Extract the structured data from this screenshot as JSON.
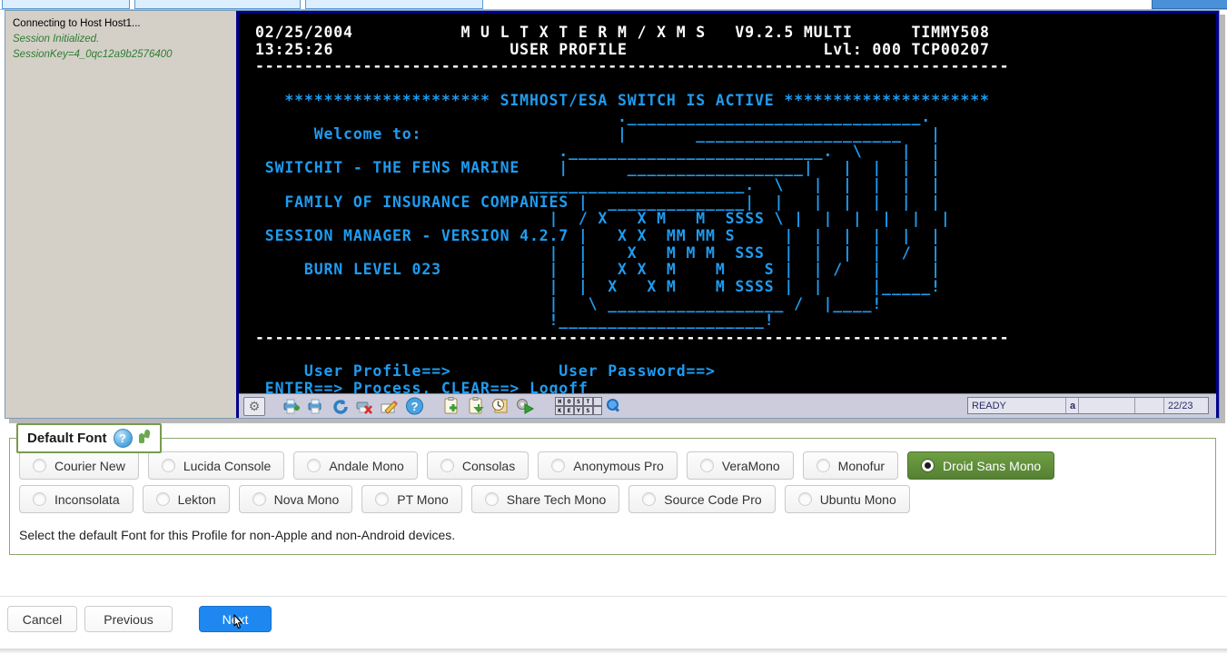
{
  "tabstrip": {
    "tabs": [
      "",
      "",
      "",
      ""
    ]
  },
  "session": {
    "status_line": "Connecting to Host Host1...",
    "initialized": "Session Initialized.",
    "session_key": "SessionKey=4_0qc12a9b2576400"
  },
  "terminal": {
    "date": "02/25/2004",
    "time": "13:25:26",
    "product": "M U L T X T E R M / X M S",
    "version": "V9.2.5 MULTI",
    "user_id": "TIMMY508",
    "screen_title": "USER PROFILE",
    "level": "Lvl: 000",
    "tcp": "TCP00207",
    "banner": "********************* SIMHOST/ESA SWITCH IS ACTIVE *********************",
    "welcome": "Welcome to:",
    "company_line1": "SWITCHIT - THE FENS MARINE",
    "company_line2": "FAMILY OF INSURANCE COMPANIES",
    "company_line3": "SESSION MANAGER - VERSION 4.2.7",
    "company_line4": "BURN LEVEL 023",
    "prompt_profile": "User Profile==>",
    "prompt_password": "User Password==>",
    "action_line": "ENTER==> Process, CLEAR==> Logoff",
    "divider": "----------------------------------------------------------------------------",
    "colors": {
      "background": "#000000",
      "text": "#1f9cf0",
      "header_text": "#ffffff",
      "border": "#00008b"
    },
    "ascii_art": [
      "                    .______________________________.",
      "                    |        ______________________ |",
      "            ._________________________________.  \\  |  |",
      "            |       _________________________|  |  |  |",
      "    _________________________________.  \\    |  |  |  |",
      "    |    ____________________________|   |   |  |  |  |",
      "    |  / X   X M   M  SSSS \\   |   |  |  |  |",
      "    |  |   X X  MM MM S       |   |   |  |  |  |",
      "    |  |    X   M M M  SSS    |   |   |  |  /  |",
      "    |  |   X X  M    M     S  |   |  /   |     |",
      "    |  |  X   X M    M SSSS   |   |      |_____!",
      "    |   \\ ____________________ /  |_____!",
      "    !_________________________!"
    ]
  },
  "toolbar": {
    "icons": [
      "settings-window-icon",
      "printer-add-icon",
      "printer-icon",
      "refresh-blue-icon",
      "print-cancel-icon",
      "edit-pencil-icon",
      "help-question-icon",
      "clipboard-add-icon",
      "clipboard-paste-icon",
      "history-clock-icon",
      "macro-run-icon",
      "host-keys-icon",
      "zoom-magnifier-icon"
    ],
    "host_keys_label": [
      "H",
      "O",
      "S",
      "T",
      "",
      "K",
      "E",
      "Y",
      "S",
      ""
    ]
  },
  "status_fields": {
    "ready": "READY",
    "indicator": "a",
    "blank1": "",
    "blank2": "",
    "position": "22/23"
  },
  "groupbox": {
    "legend": "Default Font",
    "help_icon": "?",
    "description": "Select the default Font for this Profile for non-Apple and non-Android devices.",
    "accent_color": "#7a9a4e",
    "selected_color": "#5f8f38",
    "selected_font": "Droid Sans Mono",
    "rows": [
      [
        {
          "label": "Courier New",
          "selected": false
        },
        {
          "label": "Lucida Console",
          "selected": false
        },
        {
          "label": "Andale Mono",
          "selected": false
        },
        {
          "label": "Consolas",
          "selected": false
        },
        {
          "label": "Anonymous Pro",
          "selected": false
        },
        {
          "label": "VeraMono",
          "selected": false
        },
        {
          "label": "Monofur",
          "selected": false
        },
        {
          "label": "Droid Sans Mono",
          "selected": true
        }
      ],
      [
        {
          "label": "Inconsolata",
          "selected": false
        },
        {
          "label": "Lekton",
          "selected": false
        },
        {
          "label": "Nova Mono",
          "selected": false
        },
        {
          "label": "PT Mono",
          "selected": false
        },
        {
          "label": "Share Tech Mono",
          "selected": false
        },
        {
          "label": "Source Code Pro",
          "selected": false
        },
        {
          "label": "Ubuntu Mono",
          "selected": false
        }
      ]
    ]
  },
  "footer": {
    "cancel": "Cancel",
    "previous": "Previous",
    "next": "Next",
    "primary_color": "#1e88f0"
  }
}
